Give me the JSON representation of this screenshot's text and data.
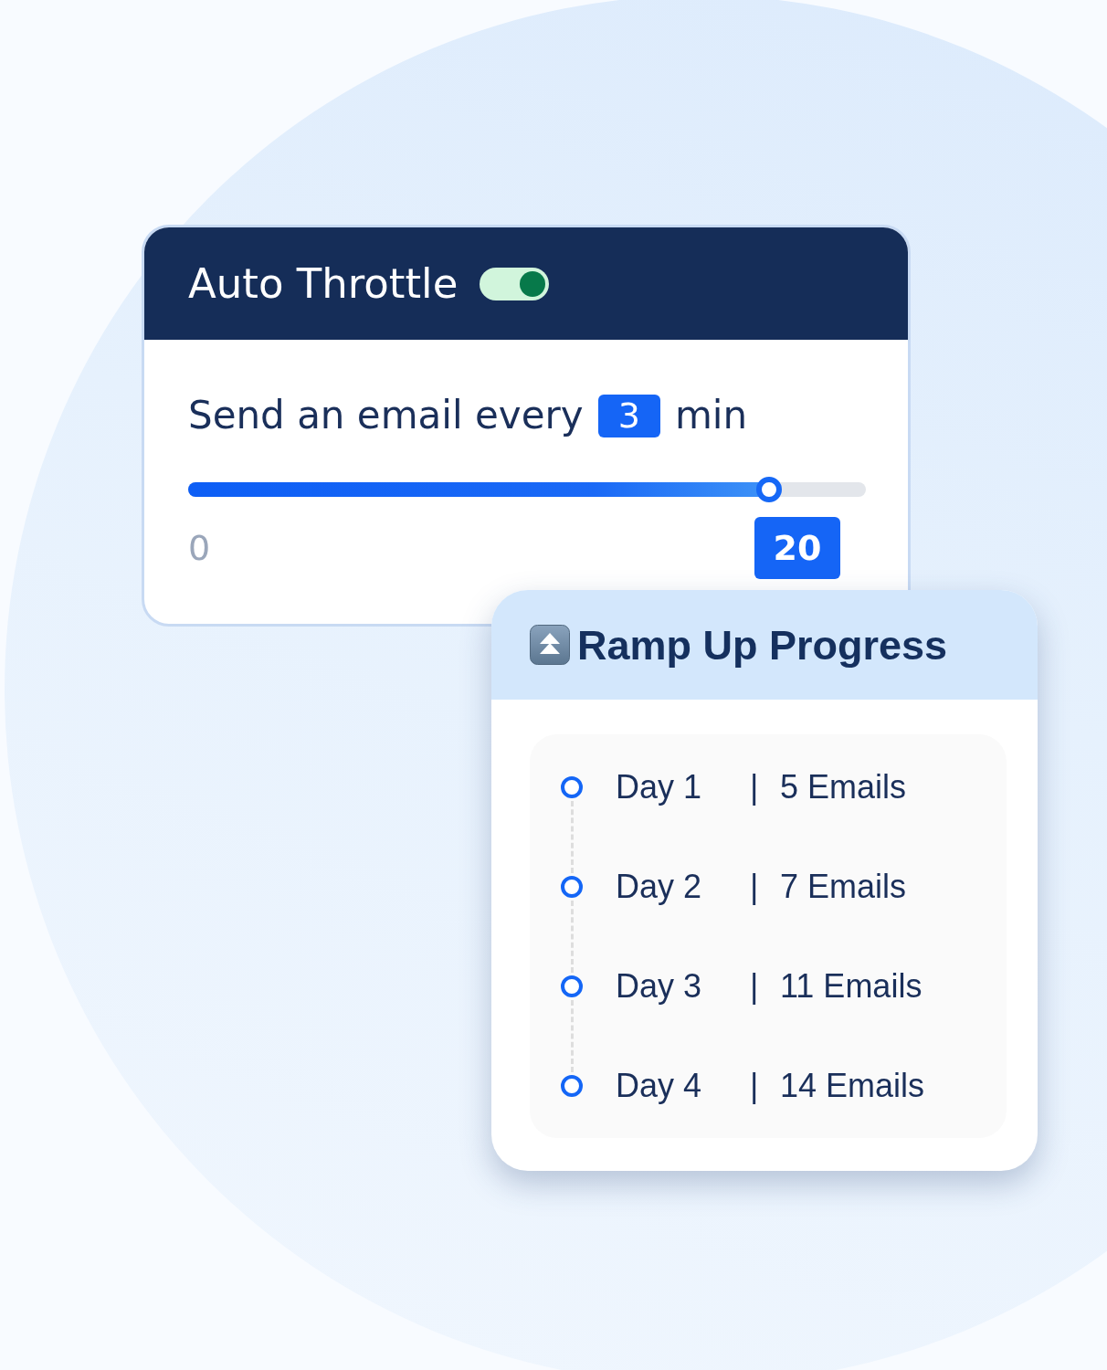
{
  "throttle_card": {
    "title": "Auto Throttle",
    "toggle": {
      "on": true
    },
    "interval": {
      "prefix": "Send an email every",
      "value": "3",
      "unit": "min"
    },
    "slider": {
      "level": 0.857,
      "min_label": "0",
      "max_label": "20"
    }
  },
  "ramp_up_card": {
    "title": "Ramp Up Progress",
    "days": [
      {
        "day": "Day 1",
        "separator": "|",
        "emails": "5 Emails"
      },
      {
        "day": "Day 2",
        "separator": "|",
        "emails": "7 Emails"
      },
      {
        "day": "Day 3",
        "separator": "|",
        "emails": "11 Emails"
      },
      {
        "day": "Day 4",
        "separator": "|",
        "emails": "14 Emails"
      }
    ]
  }
}
